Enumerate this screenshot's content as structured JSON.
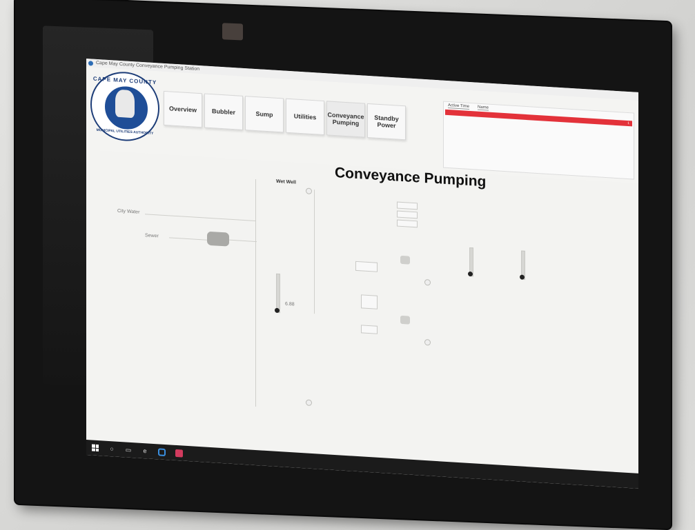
{
  "window": {
    "title": "Cape May County Conveyance Pumping Station"
  },
  "logo": {
    "top_text": "CAPE MAY COUNTY",
    "bottom_text": "MUNICIPAL UTILITIES AUTHORITY"
  },
  "tabs": [
    {
      "label": "Overview"
    },
    {
      "label": "Bubbler"
    },
    {
      "label": "Sump"
    },
    {
      "label": "Utilities"
    },
    {
      "label": "Conveyance\nPumping",
      "active": true
    },
    {
      "label": "Standby\nPower"
    }
  ],
  "alarm_panel": {
    "columns": [
      "Active Time",
      "Name"
    ],
    "banner_text": "",
    "count": "1"
  },
  "page": {
    "title": "Conveyance Pumping"
  },
  "diagram": {
    "wet_well_label": "Wet Well",
    "left_labels": [
      "City Water",
      "Sewer"
    ],
    "level_value": "6.88"
  },
  "colors": {
    "alarm": "#e3323a",
    "accent": "#1f4e97",
    "taskbar": "#1b1b1b"
  },
  "taskbar": {
    "icons": [
      "start-icon",
      "search-icon",
      "task-view-icon",
      "edge-icon",
      "hmi-app-icon",
      "pdf-app-icon"
    ],
    "tray_text": ""
  }
}
